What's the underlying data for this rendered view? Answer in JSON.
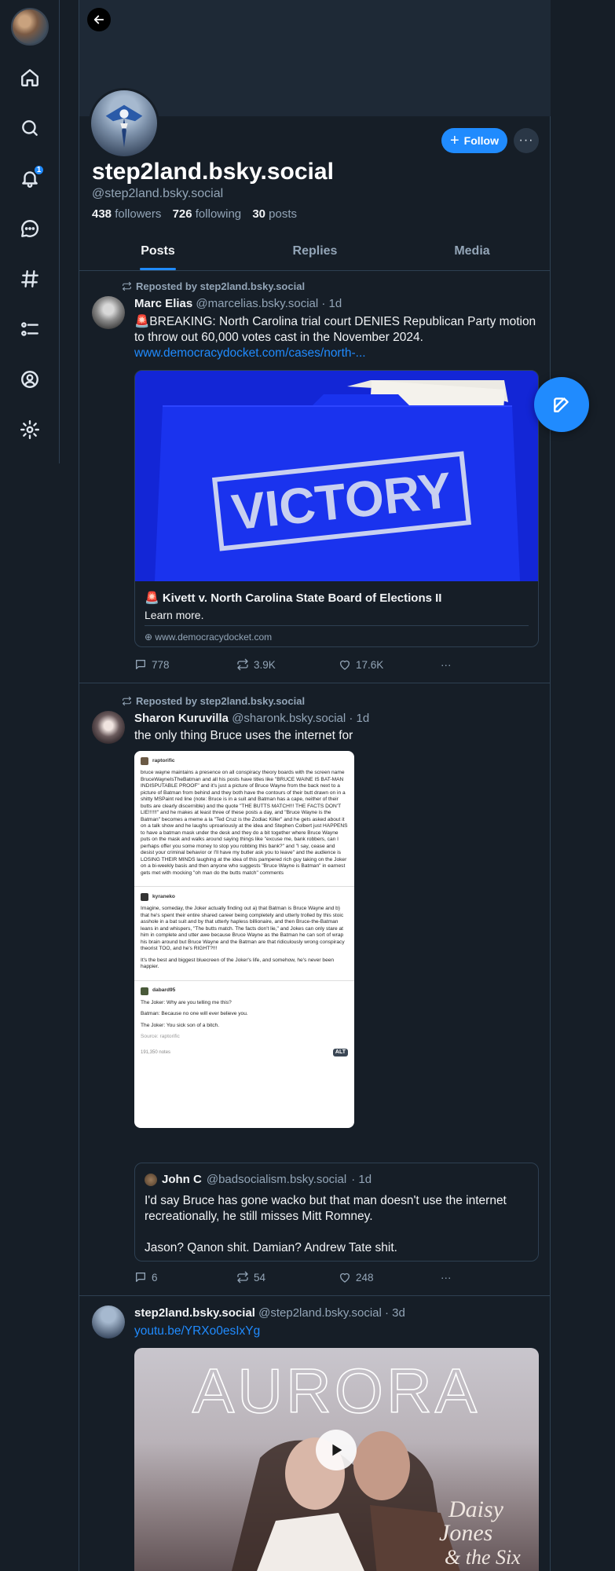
{
  "nav": {
    "notifications_badge": "1"
  },
  "profile": {
    "display_name": "step2land.bsky.social",
    "handle": "@step2land.bsky.social",
    "followers_count": "438",
    "followers_label": "followers",
    "following_count": "726",
    "following_label": "following",
    "posts_count": "30",
    "posts_label": "posts",
    "follow_label": "Follow"
  },
  "tabs": [
    "Posts",
    "Replies",
    "Media"
  ],
  "posts": [
    {
      "repost_label": "Reposted by step2land.bsky.social",
      "author_name": "Marc Elias",
      "author_handle": "@marcelias.bsky.social",
      "time": "· 1d",
      "text": "🚨BREAKING: North Carolina trial court DENIES Republican Party motion to throw out 60,000 votes cast in the November 2024.",
      "link_text": "www.democracydocket.com/cases/north-...",
      "card": {
        "image_text": "VICTORY",
        "title": "🚨 Kivett v. North Carolina State Board of Elections II",
        "description": "Learn more.",
        "domain": "www.democracydocket.com"
      },
      "replies": "778",
      "reposts": "3.9K",
      "likes": "17.6K"
    },
    {
      "repost_label": "Reposted by step2land.bsky.social",
      "author_name": "Sharon Kuruvilla",
      "author_handle": "@sharonk.bsky.social",
      "time": "· 1d",
      "text": "the only thing Bruce uses the internet for",
      "screenshot": {
        "user1": "raptorific",
        "text1": "bruce wayne maintains a presence on all conspiracy theory boards with the screen name BruceWayneIsTheBatman and all his posts have titles like \"BRUCE WAINE IS BAT-MAN INDISPUTABLE PROOF\" and it's just a picture of Bruce Wayne from the back next to a picture of Batman from behind and they both have the contours of their butt drawn on in a shitty MSPaint red line (note: Bruce is in a suit and Batman has a cape, neither of their butts are clearly discernible) and the quote \"THE BUTTS MATCH!!! THE FACTS DON'T LIE!!!!!!\" and he makes at least three of these posts a day, and \"Bruce Wayne is the Batman\" becomes a meme a la \"Ted Cruz is the Zodiac Killer\" and he gets asked about it on a talk show and he laughs uproariously at the idea and Stephen Colbert just HAPPENS to have a batman mask under the desk and they do a bit together where Bruce Wayne puts on the mask and walks around saying things like \"excuse me, bank robbers, can I perhaps offer you some money to stop you robbing this bank?\" and \"I say, cease and desist your criminal behavior or I'll have my butler ask you to leave\" and the audience is LOSING THEIR MINDS laughing at the idea of this pampered rich guy taking on the Joker on a bi-weekly basis and then anyone who suggests \"Bruce Wayne is Batman\" in earnest gets met with mocking \"oh man do the butts match\" comments",
        "user2": "kyraneko",
        "text2a": "Imagine, someday, the Joker actually finding out a) that Batman is Bruce Wayne and b) that he's spent their entire shared career being completely and utterly trolled by this stoic asshole in a bat suit and by that utterly hapless billionaire, and then Bruce-the-Batman leans in and whispers, \"The butts match. The facts don't lie,\" and Jokes can only stare at him in complete and utter awe because Bruce Wayne as the Batman he can sort of wrap his brain around but Bruce Wayne and the Batman are that ridiculously wrong conspiracy theorist TOO, and he's RIGHT?!!!",
        "text2b": "It's the best and biggest bluecreen of the Joker's life, and somehow, he's never been happier.",
        "user3": "dabard95",
        "text3a": "The Joker: Why are you telling me this?",
        "text3b": "Batman: Because no one will ever believe you.",
        "text3c": "The Joker: You sick son of a bitch.",
        "source": "Source: raptorific",
        "notes": "191,350 notes",
        "alt": "ALT"
      },
      "quote": {
        "author_name": "John C",
        "author_handle": "@badsocialism.bsky.social",
        "time": "· 1d",
        "text1": "I'd say Bruce has gone wacko but that man doesn't use the internet recreationally, he still misses Mitt Romney.",
        "text2": "Jason? Qanon shit. Damian? Andrew Tate shit."
      },
      "replies": "6",
      "reposts": "54",
      "likes": "248"
    },
    {
      "author_name": "step2land.bsky.social",
      "author_handle": "@step2land.bsky.social",
      "time": "· 3d",
      "link_text": "youtu.be/YRXo0esIxYg",
      "video_title": "AURORA",
      "video_brand_1": "Daisy",
      "video_brand_2": "Jones",
      "video_brand_3": "& the Six"
    }
  ]
}
